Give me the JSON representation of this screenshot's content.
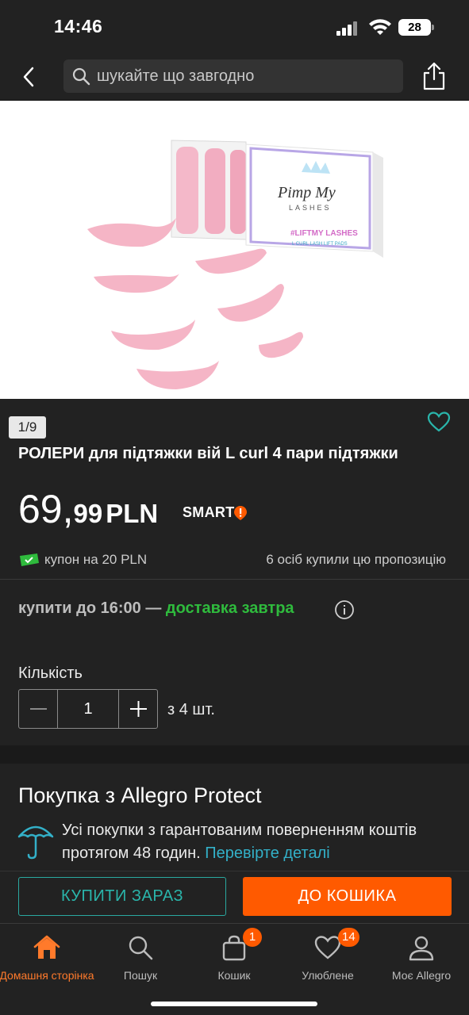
{
  "status": {
    "time": "14:46",
    "battery": "28"
  },
  "nav": {
    "search_placeholder": "шукайте що завгодно"
  },
  "product": {
    "image_counter": "1/9",
    "title": "РОЛЕРИ для підтяжки вій L curl 4 пари підтяжки",
    "price_int": "69,",
    "price_frac": "99",
    "currency": "PLN",
    "smart_label": "SMART",
    "coupon": "купон на 20 PLN",
    "bought": "6 осіб купили цю пропозицію",
    "delivery_prefix": "купити до 16:00 — ",
    "delivery_highlight": "доставка завтра",
    "quantity_label": "Кількість",
    "quantity_value": "1",
    "quantity_available": "з 4 шт.",
    "box_brand_line1": "Pimp My",
    "box_brand_line2": "LASHES",
    "box_tag": "#LIFTMY LASHES",
    "box_sub": "L CURL LASH LIFT PADS"
  },
  "protect": {
    "title": "Покупка з Allegro Protect",
    "text": "Усі покупки з гарантованим поверненням коштів протягом 48 годин. ",
    "link": "Перевірте деталі"
  },
  "cta": {
    "buy_now": "КУПИТИ ЗАРАЗ",
    "add_to_cart": "ДО КОШИКА"
  },
  "tabs": [
    {
      "label": "Домашня сторінка",
      "icon": "home-icon",
      "active": true
    },
    {
      "label": "Пошук",
      "icon": "search-icon"
    },
    {
      "label": "Кошик",
      "icon": "cart-icon",
      "badge": "1"
    },
    {
      "label": "Улюблене",
      "icon": "heart-icon",
      "badge": "14"
    },
    {
      "label": "Моє Allegro",
      "icon": "user-icon"
    }
  ],
  "colors": {
    "accent": "#ff5a00",
    "teal": "#2ab5ab",
    "green": "#2fbb3d",
    "background": "#222222"
  }
}
